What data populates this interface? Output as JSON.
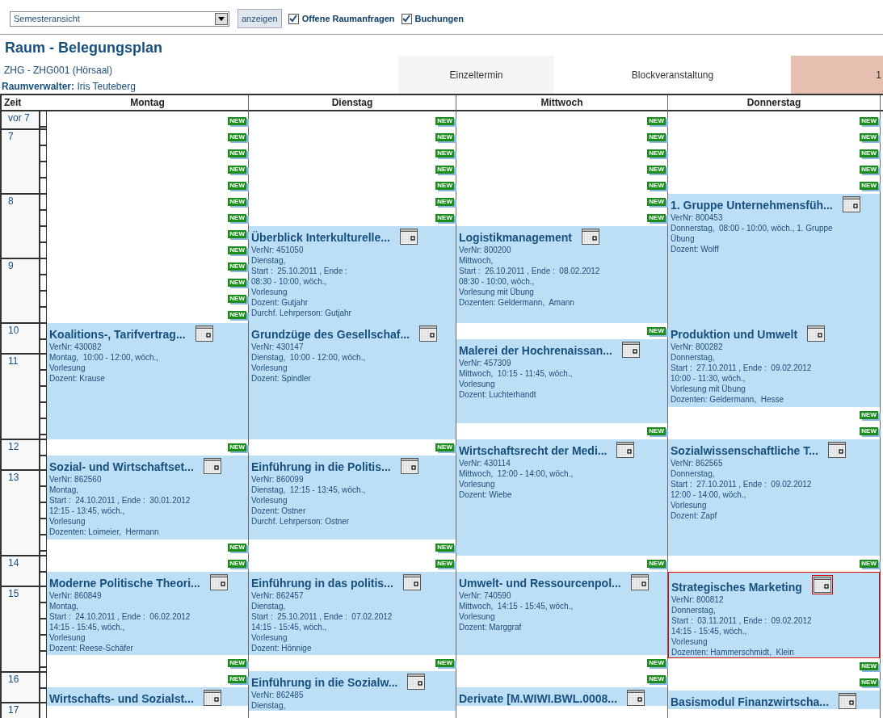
{
  "toolbar": {
    "view_select": "Semesteransicht",
    "show_button": "anzeigen",
    "checkboxes": [
      {
        "label": "Offene Raumanfragen",
        "checked": true
      },
      {
        "label": "Buchungen",
        "checked": true
      }
    ]
  },
  "title": "Raum - Belegungsplan",
  "room": "ZHG - ZHG001 (Hörsaal)",
  "manager": "**Raumverwalter:** Iris Teuteberg",
  "legend": [
    {
      "label": "Einzeltermin",
      "color": "#f5f5f5"
    },
    {
      "label": "Blockveranstaltung",
      "color": "#ffffff"
    },
    {
      "label": "1",
      "color": "#e6bfb0"
    }
  ],
  "time_header": "Zeit",
  "times": [
    "vor 7",
    "7",
    "8",
    "9",
    "10",
    "11",
    "12",
    "13",
    "14",
    "15",
    "16",
    "17"
  ],
  "days": [
    {
      "label": "Montag",
      "segments": [
        {
          "kind": "new",
          "label": "NEW"
        },
        {
          "kind": "new",
          "label": "NEW"
        },
        {
          "kind": "new",
          "label": "NEW"
        },
        {
          "kind": "new",
          "label": "NEW"
        },
        {
          "kind": "new",
          "label": "NEW"
        },
        {
          "kind": "new",
          "label": "NEW"
        },
        {
          "kind": "new",
          "label": "NEW"
        },
        {
          "kind": "new",
          "label": "NEW"
        },
        {
          "kind": "new",
          "label": "NEW"
        },
        {
          "kind": "new",
          "label": "NEW"
        },
        {
          "kind": "new",
          "label": "NEW"
        },
        {
          "kind": "new",
          "label": "NEW"
        },
        {
          "kind": "new",
          "label": "NEW"
        },
        {
          "kind": "event",
          "title": "Koalitions-, Tarifvertrag...",
          "lines": [
            "VerNr: 430082",
            "Montag,  10:00 - 12:00, wöch.,",
            "Vorlesung",
            "Dozent: Krause"
          ],
          "selected": false
        },
        {
          "kind": "new",
          "label": "NEW"
        },
        {
          "kind": "event",
          "title": "Sozial- und Wirtschaftset...",
          "lines": [
            "VerNr: 862560",
            "Montag,",
            "Start :  24.10.2011 , Ende :  30.01.2012",
            "12:15 - 13:45, wöch.,",
            "Vorlesung",
            "Dozenten: Loimeier,  Hermann"
          ],
          "selected": false
        },
        {
          "kind": "new",
          "label": "NEW"
        },
        {
          "kind": "new",
          "label": "NEW"
        },
        {
          "kind": "event",
          "title": "Moderne Politische Theori...",
          "lines": [
            "VerNr: 860849",
            "Montag,",
            "Start :  24.10.2011 , Ende :  06.02.2012",
            "14:15 - 15:45, wöch.,",
            "Vorlesung",
            "Dozent: Reese-Schäfer"
          ],
          "selected": false
        },
        {
          "kind": "new",
          "label": "NEW"
        },
        {
          "kind": "new",
          "label": "NEW"
        },
        {
          "kind": "event",
          "title": "Wirtschafts- und Sozialst...",
          "selected": false
        }
      ]
    },
    {
      "label": "Dienstag",
      "segments": [
        {
          "kind": "new",
          "label": "NEW"
        },
        {
          "kind": "new",
          "label": "NEW"
        },
        {
          "kind": "new",
          "label": "NEW"
        },
        {
          "kind": "new",
          "label": "NEW"
        },
        {
          "kind": "new",
          "label": "NEW"
        },
        {
          "kind": "new",
          "label": "NEW"
        },
        {
          "kind": "new",
          "label": "NEW"
        },
        {
          "kind": "event",
          "title": "Überblick Interkulturelle...",
          "lines": [
            "VerNr: 451050",
            "Dienstag,",
            "Start :  25.10.2011 , Ende :",
            "08:30 - 10:00, wöch.,",
            "Vorlesung",
            "Dozent: Gutjahr",
            "Durchf. Lehrperson: Gutjahr"
          ],
          "selected": false
        },
        {
          "kind": "event",
          "title": "Grundzüge des Gesellschaf...",
          "lines": [
            "VerNr: 430147",
            "Dienstag,  10:00 - 12:00, wöch.,",
            "Vorlesung",
            "Dozent: Spindler"
          ],
          "selected": false
        },
        {
          "kind": "new",
          "label": "NEW"
        },
        {
          "kind": "event",
          "title": "Einführung in die Politis...",
          "lines": [
            "VerNr: 860099",
            "Dienstag,  12:15 - 13:45, wöch.,",
            "Vorlesung",
            "Dozent: Ostner",
            "Durchf. Lehrperson: Ostner"
          ],
          "selected": false
        },
        {
          "kind": "new",
          "label": "NEW"
        },
        {
          "kind": "new",
          "label": "NEW"
        },
        {
          "kind": "event",
          "title": "Einführung in das politis...",
          "lines": [
            "VerNr: 862457",
            "Dienstag,",
            "Start :  25.10.2011 , Ende :  07.02.2012",
            "14:15 - 15:45, wöch.,",
            "Vorlesung",
            "Dozent: Hönnige"
          ],
          "selected": false
        },
        {
          "kind": "new",
          "label": "NEW"
        },
        {
          "kind": "event",
          "title": "Einführung in die Sozialw...",
          "lines": [
            "VerNr: 862485",
            "Dienstag,"
          ],
          "selected": false
        }
      ]
    },
    {
      "label": "Mittwoch",
      "segments": [
        {
          "kind": "new",
          "label": "NEW"
        },
        {
          "kind": "new",
          "label": "NEW"
        },
        {
          "kind": "new",
          "label": "NEW"
        },
        {
          "kind": "new",
          "label": "NEW"
        },
        {
          "kind": "new",
          "label": "NEW"
        },
        {
          "kind": "new",
          "label": "NEW"
        },
        {
          "kind": "new",
          "label": "NEW"
        },
        {
          "kind": "event",
          "title": "Logistikmanagement",
          "lines": [
            "VerNr: 800200",
            "Mittwoch,",
            "Start :  26.10.2011 , Ende :  08.02.2012",
            "08:30 - 10:00, wöch.,",
            "Vorlesung mit Übung",
            "Dozenten: Geldermann,  Amann"
          ],
          "selected": false
        },
        {
          "kind": "new",
          "label": "NEW"
        },
        {
          "kind": "event",
          "title": "Malerei der Hochrenaissan...",
          "lines": [
            "VerNr: 457309",
            "Mittwoch,  10:15 - 11:45, wöch.,",
            "Vorlesung",
            "Dozent: Luchterhandt"
          ],
          "selected": false
        },
        {
          "kind": "new",
          "label": "NEW"
        },
        {
          "kind": "event",
          "title": "Wirtschaftsrecht der Medi...",
          "lines": [
            "VerNr: 430114",
            "Mittwoch,  12:00 - 14:00, wöch.,",
            "Vorlesung",
            "Dozent: Wiebe"
          ],
          "selected": false
        },
        {
          "kind": "new",
          "label": "NEW"
        },
        {
          "kind": "event",
          "title": "Umwelt- und Ressourcenpol...",
          "lines": [
            "VerNr: 740590",
            "Mittwoch,  14:15 - 15:45, wöch.,",
            "Vorlesung",
            "Dozent: Marggraf"
          ],
          "selected": false
        },
        {
          "kind": "new",
          "label": "NEW"
        },
        {
          "kind": "new",
          "label": "NEW"
        },
        {
          "kind": "event",
          "title": "Derivate [M.WIWI.BWL.0008...",
          "selected": false
        }
      ]
    },
    {
      "label": "Donnerstag",
      "segments": [
        {
          "kind": "new",
          "label": "NEW"
        },
        {
          "kind": "new",
          "label": "NEW"
        },
        {
          "kind": "new",
          "label": "NEW"
        },
        {
          "kind": "new",
          "label": "NEW"
        },
        {
          "kind": "new",
          "label": "NEW"
        },
        {
          "kind": "event",
          "title": "1. Gruppe Unternehmensfüh...",
          "lines": [
            "VerNr: 800453",
            "Donnerstag,  08:00 - 10:00, wöch., 1. Gruppe",
            "Übung",
            "Dozent: Wolff"
          ],
          "selected": false
        },
        {
          "kind": "event",
          "title": "Produktion und Umwelt",
          "lines": [
            "VerNr: 800282",
            "Donnerstag,",
            "Start :  27.10.2011 , Ende :  09.02.2012",
            "10:00 - 11:30, wöch.,",
            "Vorlesung mit Übung",
            "Dozenten: Geldermann,  Hesse"
          ],
          "selected": false
        },
        {
          "kind": "new",
          "label": "NEW"
        },
        {
          "kind": "new",
          "label": "NEW"
        },
        {
          "kind": "event",
          "title": "Sozialwissenschaftliche T...",
          "lines": [
            "VerNr: 862565",
            "Donnerstag,",
            "Start :  27.10.2011 , Ende :  09.02.2012",
            "12:00 - 14:00, wöch.,",
            "Vorlesung",
            "Dozent: Zapf"
          ],
          "selected": false
        },
        {
          "kind": "new",
          "label": "NEW"
        },
        {
          "kind": "event",
          "title": "Strategisches Marketing",
          "lines": [
            "VerNr: 800812",
            "Donnerstag,",
            "Start :  03.11.2011 , Ende :  09.02.2012",
            "14:15 - 15:45, wöch.,",
            "Vorlesung",
            "Dozenten: Hammerschmidt,  Klein"
          ],
          "selected": true
        },
        {
          "kind": "new",
          "label": "NEW"
        },
        {
          "kind": "new",
          "label": "NEW"
        },
        {
          "kind": "event",
          "title": "Basismodul Finanzwirtscha...",
          "selected": false
        }
      ]
    }
  ]
}
